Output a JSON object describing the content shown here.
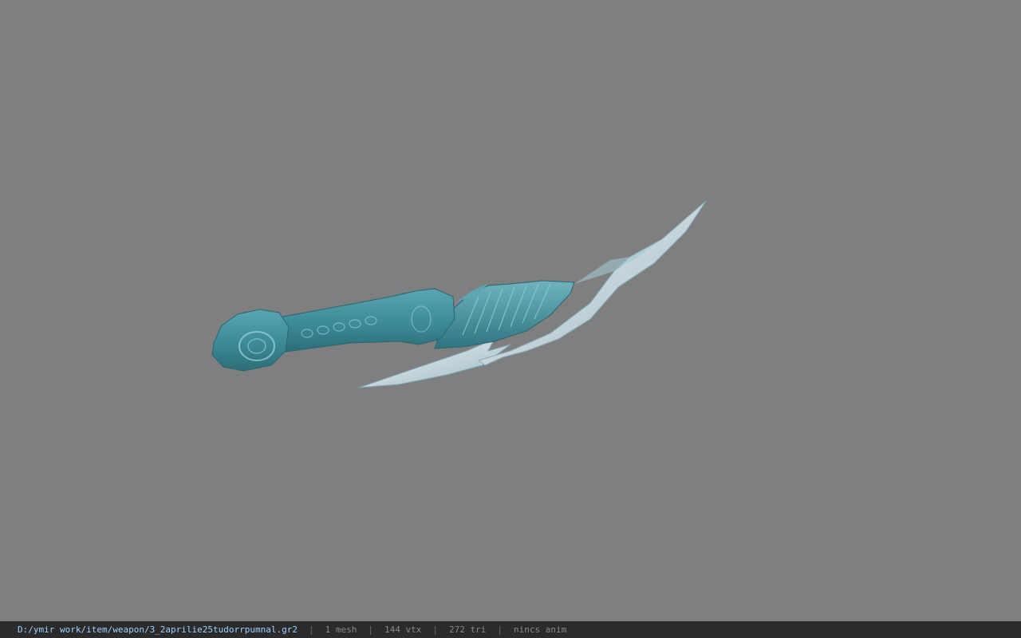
{
  "viewer": {
    "background_color": "#7f7f7f",
    "model": {
      "name": "dagger",
      "handle_color": "#3e8c99",
      "blade_color": "#cdd9df"
    }
  },
  "status_bar": {
    "file_path": "D:/ymir work/item/weapon/3_2aprilie25tudorrpumnal.gr2",
    "sep": "|",
    "mesh_count": "1 mesh",
    "vertex_count": "144 vtx",
    "triangle_count": "272 tri",
    "anim_status": "nincs anim"
  }
}
